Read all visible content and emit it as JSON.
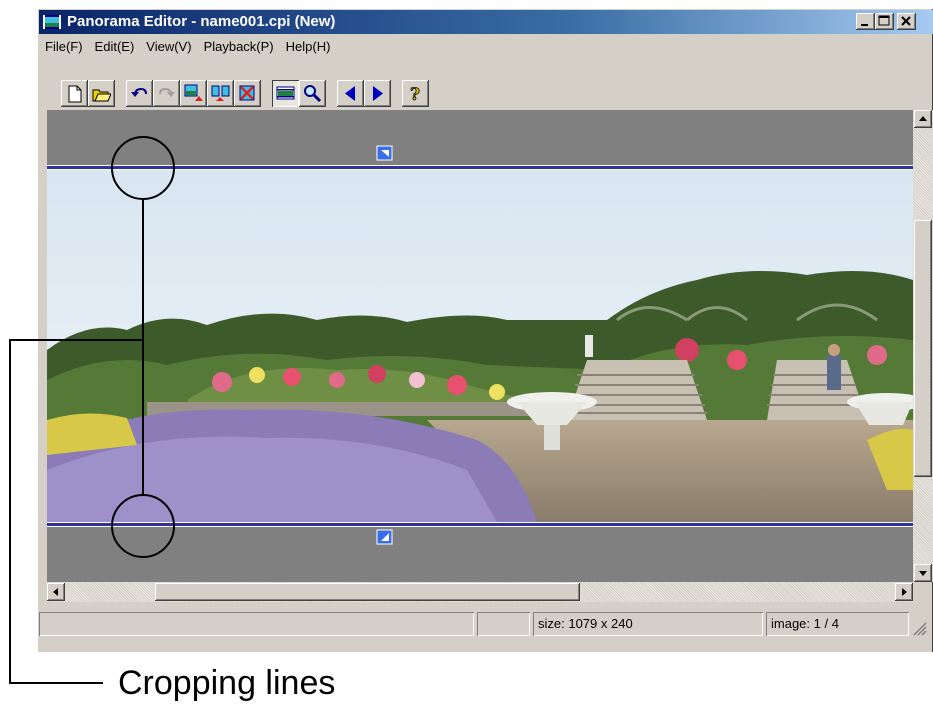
{
  "window": {
    "title": "Panorama Editor - name001.cpi (New)",
    "title_buttons": [
      "minimize-icon",
      "maximize-icon",
      "close-icon"
    ]
  },
  "menu": [
    {
      "label": "File(F)"
    },
    {
      "label": "Edit(E)"
    },
    {
      "label": "View(V)"
    },
    {
      "label": "Playback(P)"
    },
    {
      "label": "Help(H)"
    }
  ],
  "toolbar": [
    {
      "icon": "new-document-icon"
    },
    {
      "icon": "open-folder-icon"
    },
    {
      "icon": "undo-icon"
    },
    {
      "icon": "redo-icon",
      "disabled": true
    },
    {
      "icon": "insert-image-icon"
    },
    {
      "icon": "swap-images-icon"
    },
    {
      "icon": "delete-image-icon"
    },
    {
      "icon": "crop-view-icon",
      "pressed": true
    },
    {
      "icon": "zoom-icon"
    },
    {
      "icon": "previous-icon"
    },
    {
      "icon": "next-icon"
    },
    {
      "icon": "help-icon"
    }
  ],
  "status": {
    "size": "size: 1079 x 240",
    "image": "image: 1 / 4"
  },
  "annotation": {
    "label": "Cropping lines"
  },
  "colors": {
    "titlebar_start": "#0a246a",
    "titlebar_end": "#a6caf0",
    "crop_line": "#3030a0",
    "crop_marker": "#3a6ee8"
  }
}
